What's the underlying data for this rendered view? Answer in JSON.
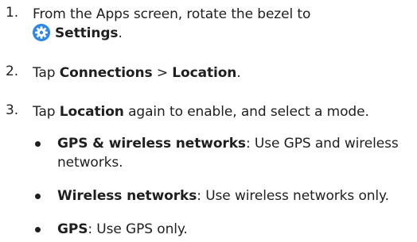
{
  "steps": [
    {
      "number": "1.",
      "text_before": "From the Apps screen, rotate the bezel to",
      "icon": "settings-gear-icon",
      "bold": "Settings",
      "text_after": "."
    },
    {
      "number": "2.",
      "text_before": "Tap ",
      "bold1": "Connections",
      "separator": " > ",
      "bold2": "Location",
      "text_after": "."
    },
    {
      "number": "3.",
      "text_before": "Tap ",
      "bold": "Location",
      "text_after": " again to enable, and select a mode."
    }
  ],
  "bullets": [
    {
      "bold": "GPS & wireless networks",
      "text": ": Use GPS and wireless networks."
    },
    {
      "bold": "Wireless networks",
      "text": ": Use wireless networks only."
    },
    {
      "bold": "GPS",
      "text": ": Use GPS only."
    }
  ],
  "colors": {
    "text": "#1f1f1f",
    "icon_bg": "#2e86e6"
  }
}
